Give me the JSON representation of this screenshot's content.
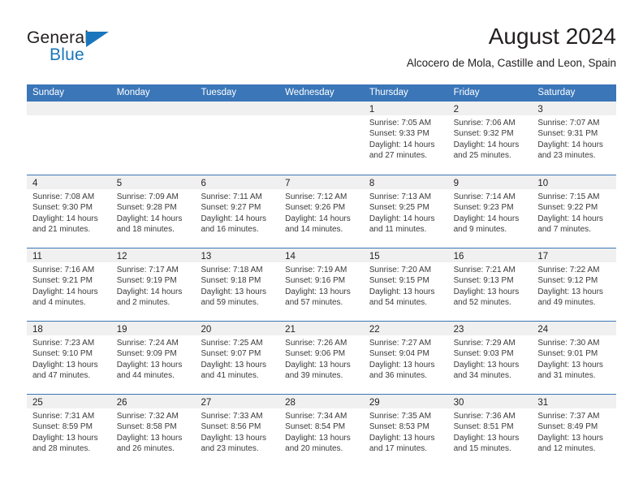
{
  "brand": {
    "name_part1": "General",
    "name_part2": "Blue"
  },
  "header": {
    "title": "August 2024",
    "subtitle": "Alcocero de Mola, Castille and Leon, Spain"
  },
  "colors": {
    "header_blue": "#3a76b8",
    "brand_blue": "#1a76bc",
    "day_band_gray": "#f0f0f0",
    "text": "#231f20"
  },
  "calendar": {
    "weekdays": [
      "Sunday",
      "Monday",
      "Tuesday",
      "Wednesday",
      "Thursday",
      "Friday",
      "Saturday"
    ],
    "weeks": [
      [
        {
          "day": "",
          "lines": []
        },
        {
          "day": "",
          "lines": []
        },
        {
          "day": "",
          "lines": []
        },
        {
          "day": "",
          "lines": []
        },
        {
          "day": "1",
          "lines": [
            "Sunrise: 7:05 AM",
            "Sunset: 9:33 PM",
            "Daylight: 14 hours",
            "and 27 minutes."
          ]
        },
        {
          "day": "2",
          "lines": [
            "Sunrise: 7:06 AM",
            "Sunset: 9:32 PM",
            "Daylight: 14 hours",
            "and 25 minutes."
          ]
        },
        {
          "day": "3",
          "lines": [
            "Sunrise: 7:07 AM",
            "Sunset: 9:31 PM",
            "Daylight: 14 hours",
            "and 23 minutes."
          ]
        }
      ],
      [
        {
          "day": "4",
          "lines": [
            "Sunrise: 7:08 AM",
            "Sunset: 9:30 PM",
            "Daylight: 14 hours",
            "and 21 minutes."
          ]
        },
        {
          "day": "5",
          "lines": [
            "Sunrise: 7:09 AM",
            "Sunset: 9:28 PM",
            "Daylight: 14 hours",
            "and 18 minutes."
          ]
        },
        {
          "day": "6",
          "lines": [
            "Sunrise: 7:11 AM",
            "Sunset: 9:27 PM",
            "Daylight: 14 hours",
            "and 16 minutes."
          ]
        },
        {
          "day": "7",
          "lines": [
            "Sunrise: 7:12 AM",
            "Sunset: 9:26 PM",
            "Daylight: 14 hours",
            "and 14 minutes."
          ]
        },
        {
          "day": "8",
          "lines": [
            "Sunrise: 7:13 AM",
            "Sunset: 9:25 PM",
            "Daylight: 14 hours",
            "and 11 minutes."
          ]
        },
        {
          "day": "9",
          "lines": [
            "Sunrise: 7:14 AM",
            "Sunset: 9:23 PM",
            "Daylight: 14 hours",
            "and 9 minutes."
          ]
        },
        {
          "day": "10",
          "lines": [
            "Sunrise: 7:15 AM",
            "Sunset: 9:22 PM",
            "Daylight: 14 hours",
            "and 7 minutes."
          ]
        }
      ],
      [
        {
          "day": "11",
          "lines": [
            "Sunrise: 7:16 AM",
            "Sunset: 9:21 PM",
            "Daylight: 14 hours",
            "and 4 minutes."
          ]
        },
        {
          "day": "12",
          "lines": [
            "Sunrise: 7:17 AM",
            "Sunset: 9:19 PM",
            "Daylight: 14 hours",
            "and 2 minutes."
          ]
        },
        {
          "day": "13",
          "lines": [
            "Sunrise: 7:18 AM",
            "Sunset: 9:18 PM",
            "Daylight: 13 hours",
            "and 59 minutes."
          ]
        },
        {
          "day": "14",
          "lines": [
            "Sunrise: 7:19 AM",
            "Sunset: 9:16 PM",
            "Daylight: 13 hours",
            "and 57 minutes."
          ]
        },
        {
          "day": "15",
          "lines": [
            "Sunrise: 7:20 AM",
            "Sunset: 9:15 PM",
            "Daylight: 13 hours",
            "and 54 minutes."
          ]
        },
        {
          "day": "16",
          "lines": [
            "Sunrise: 7:21 AM",
            "Sunset: 9:13 PM",
            "Daylight: 13 hours",
            "and 52 minutes."
          ]
        },
        {
          "day": "17",
          "lines": [
            "Sunrise: 7:22 AM",
            "Sunset: 9:12 PM",
            "Daylight: 13 hours",
            "and 49 minutes."
          ]
        }
      ],
      [
        {
          "day": "18",
          "lines": [
            "Sunrise: 7:23 AM",
            "Sunset: 9:10 PM",
            "Daylight: 13 hours",
            "and 47 minutes."
          ]
        },
        {
          "day": "19",
          "lines": [
            "Sunrise: 7:24 AM",
            "Sunset: 9:09 PM",
            "Daylight: 13 hours",
            "and 44 minutes."
          ]
        },
        {
          "day": "20",
          "lines": [
            "Sunrise: 7:25 AM",
            "Sunset: 9:07 PM",
            "Daylight: 13 hours",
            "and 41 minutes."
          ]
        },
        {
          "day": "21",
          "lines": [
            "Sunrise: 7:26 AM",
            "Sunset: 9:06 PM",
            "Daylight: 13 hours",
            "and 39 minutes."
          ]
        },
        {
          "day": "22",
          "lines": [
            "Sunrise: 7:27 AM",
            "Sunset: 9:04 PM",
            "Daylight: 13 hours",
            "and 36 minutes."
          ]
        },
        {
          "day": "23",
          "lines": [
            "Sunrise: 7:29 AM",
            "Sunset: 9:03 PM",
            "Daylight: 13 hours",
            "and 34 minutes."
          ]
        },
        {
          "day": "24",
          "lines": [
            "Sunrise: 7:30 AM",
            "Sunset: 9:01 PM",
            "Daylight: 13 hours",
            "and 31 minutes."
          ]
        }
      ],
      [
        {
          "day": "25",
          "lines": [
            "Sunrise: 7:31 AM",
            "Sunset: 8:59 PM",
            "Daylight: 13 hours",
            "and 28 minutes."
          ]
        },
        {
          "day": "26",
          "lines": [
            "Sunrise: 7:32 AM",
            "Sunset: 8:58 PM",
            "Daylight: 13 hours",
            "and 26 minutes."
          ]
        },
        {
          "day": "27",
          "lines": [
            "Sunrise: 7:33 AM",
            "Sunset: 8:56 PM",
            "Daylight: 13 hours",
            "and 23 minutes."
          ]
        },
        {
          "day": "28",
          "lines": [
            "Sunrise: 7:34 AM",
            "Sunset: 8:54 PM",
            "Daylight: 13 hours",
            "and 20 minutes."
          ]
        },
        {
          "day": "29",
          "lines": [
            "Sunrise: 7:35 AM",
            "Sunset: 8:53 PM",
            "Daylight: 13 hours",
            "and 17 minutes."
          ]
        },
        {
          "day": "30",
          "lines": [
            "Sunrise: 7:36 AM",
            "Sunset: 8:51 PM",
            "Daylight: 13 hours",
            "and 15 minutes."
          ]
        },
        {
          "day": "31",
          "lines": [
            "Sunrise: 7:37 AM",
            "Sunset: 8:49 PM",
            "Daylight: 13 hours",
            "and 12 minutes."
          ]
        }
      ]
    ]
  }
}
